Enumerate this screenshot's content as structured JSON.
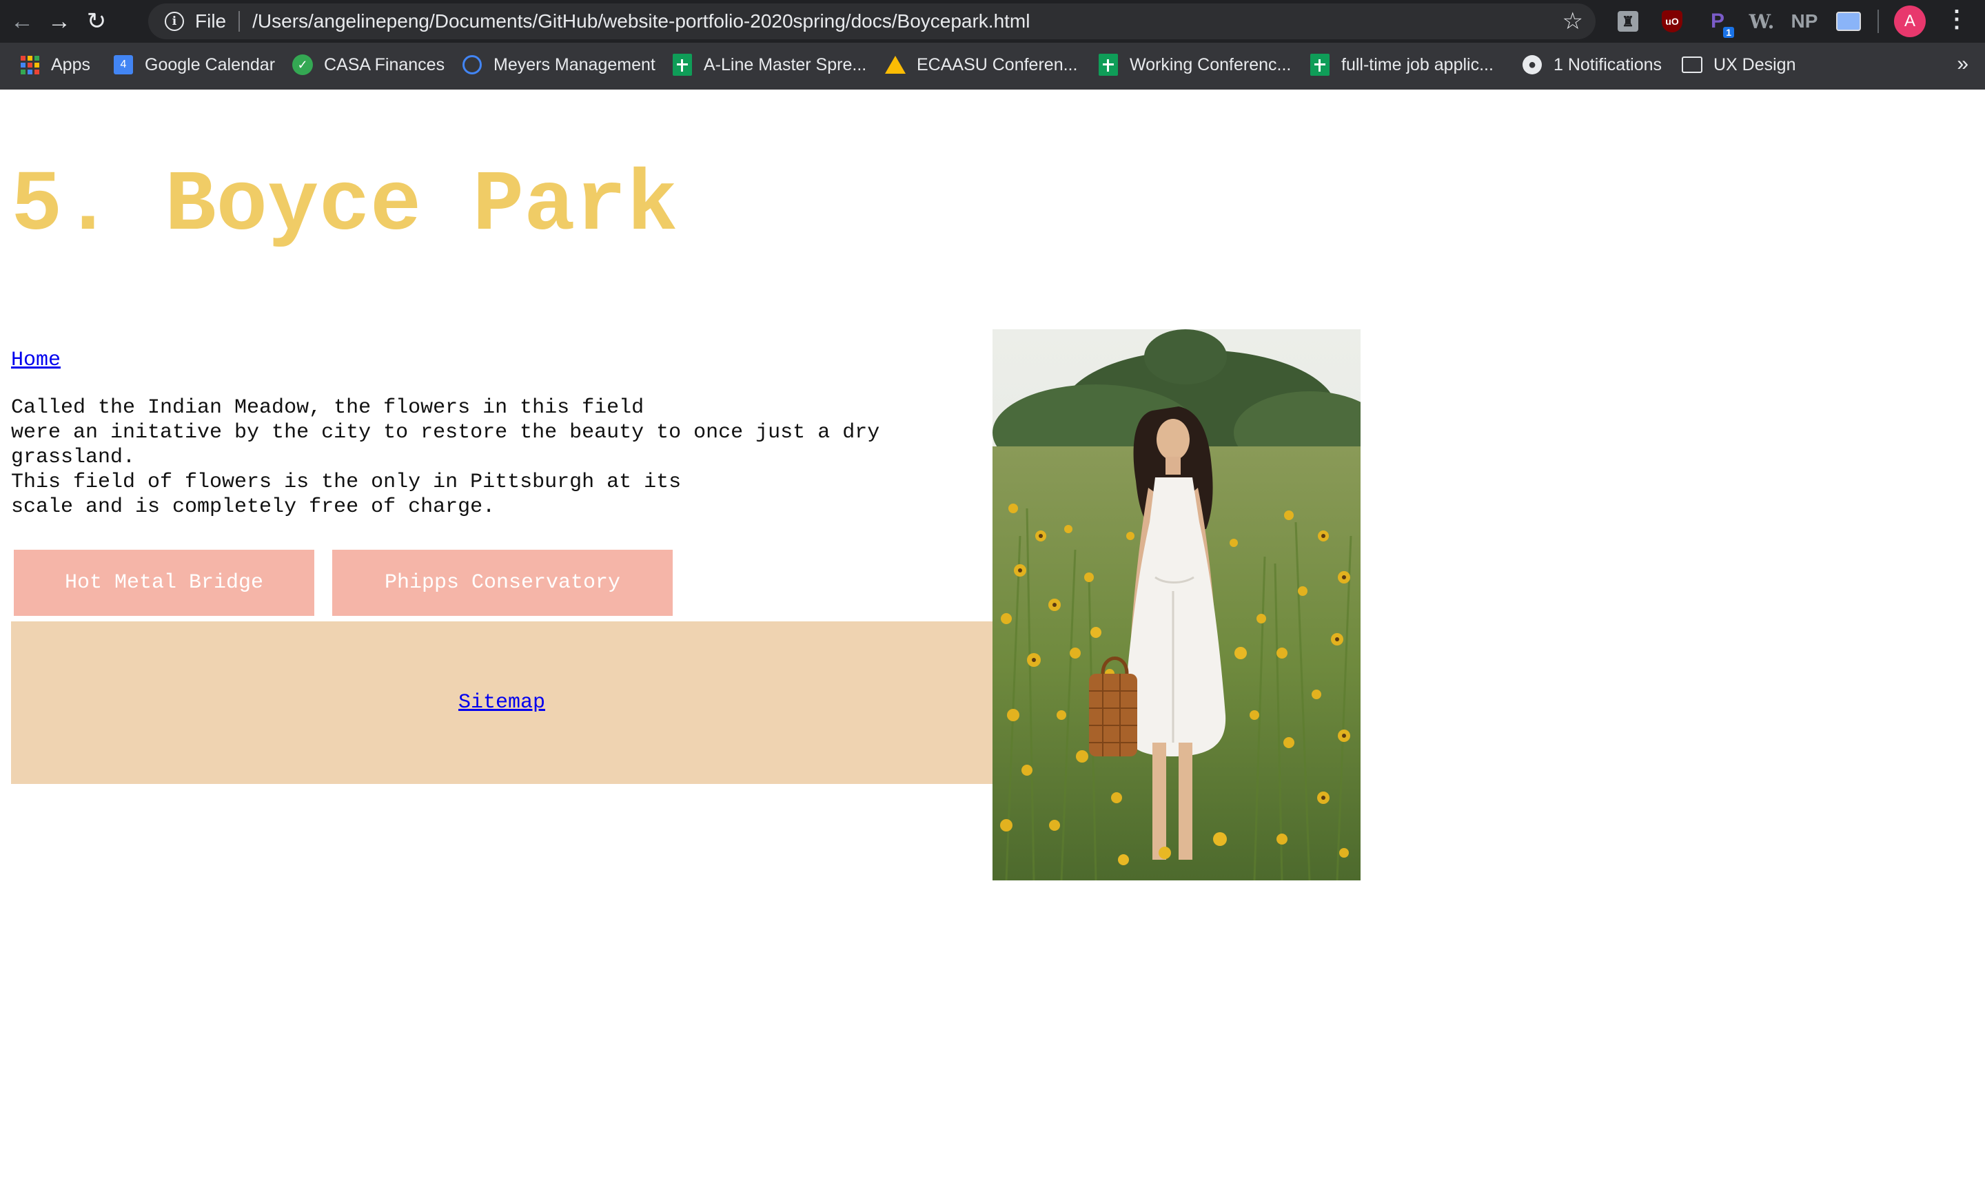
{
  "browser": {
    "scheme_label": "File",
    "url": "/Users/angelinepeng/Documents/GitHub/website-portfolio-2020spring/docs/Boycepark.html",
    "extensions": [
      {
        "icon": "tampermonkey-icon"
      },
      {
        "icon": "ublock-origin-icon",
        "text": "uO"
      },
      {
        "icon": "p-extension-icon",
        "text": "P",
        "badge": "1"
      },
      {
        "icon": "w-extension-icon",
        "text": "W."
      },
      {
        "icon": "np-extension-icon",
        "text": "NP"
      },
      {
        "icon": "mail-checker-icon"
      }
    ],
    "profile_initial": "A"
  },
  "bookmarks": [
    {
      "label": "Apps",
      "icon": "apps-grid-icon"
    },
    {
      "label": "Google Calendar",
      "icon": "google-calendar-icon",
      "icon_text": "4"
    },
    {
      "label": "CASA Finances",
      "icon": "casa-icon"
    },
    {
      "label": "Meyers Management",
      "icon": "water-drop-icon"
    },
    {
      "label": "A-Line Master Spre...",
      "icon": "google-sheets-icon"
    },
    {
      "label": "ECAASU Conferen...",
      "icon": "google-drive-icon"
    },
    {
      "label": "Working Conferenc...",
      "icon": "google-sheets-icon"
    },
    {
      "label": "full-time job applic...",
      "icon": "google-sheets-icon"
    },
    {
      "label": "1 Notifications",
      "icon": "globe-icon"
    },
    {
      "label": "UX Design",
      "icon": "folder-icon"
    }
  ],
  "page": {
    "title": "5. Boyce Park",
    "home_link": "Home",
    "description": [
      "Called the Indian Meadow, the flowers in this field",
      "were an initative by the city to restore the beauty to once just a dry grassland.",
      "This field of flowers is the only in Pittsburgh at its",
      "scale and is completely free of charge."
    ],
    "buttons": [
      "Hot Metal Bridge",
      "Phipps Conservatory"
    ],
    "footer_link": "Sitemap"
  },
  "colors": {
    "title": "#f0cc66",
    "button_bg": "#f5b5a8",
    "footer_bg": "#efd3b1",
    "link": "#0000ee"
  }
}
